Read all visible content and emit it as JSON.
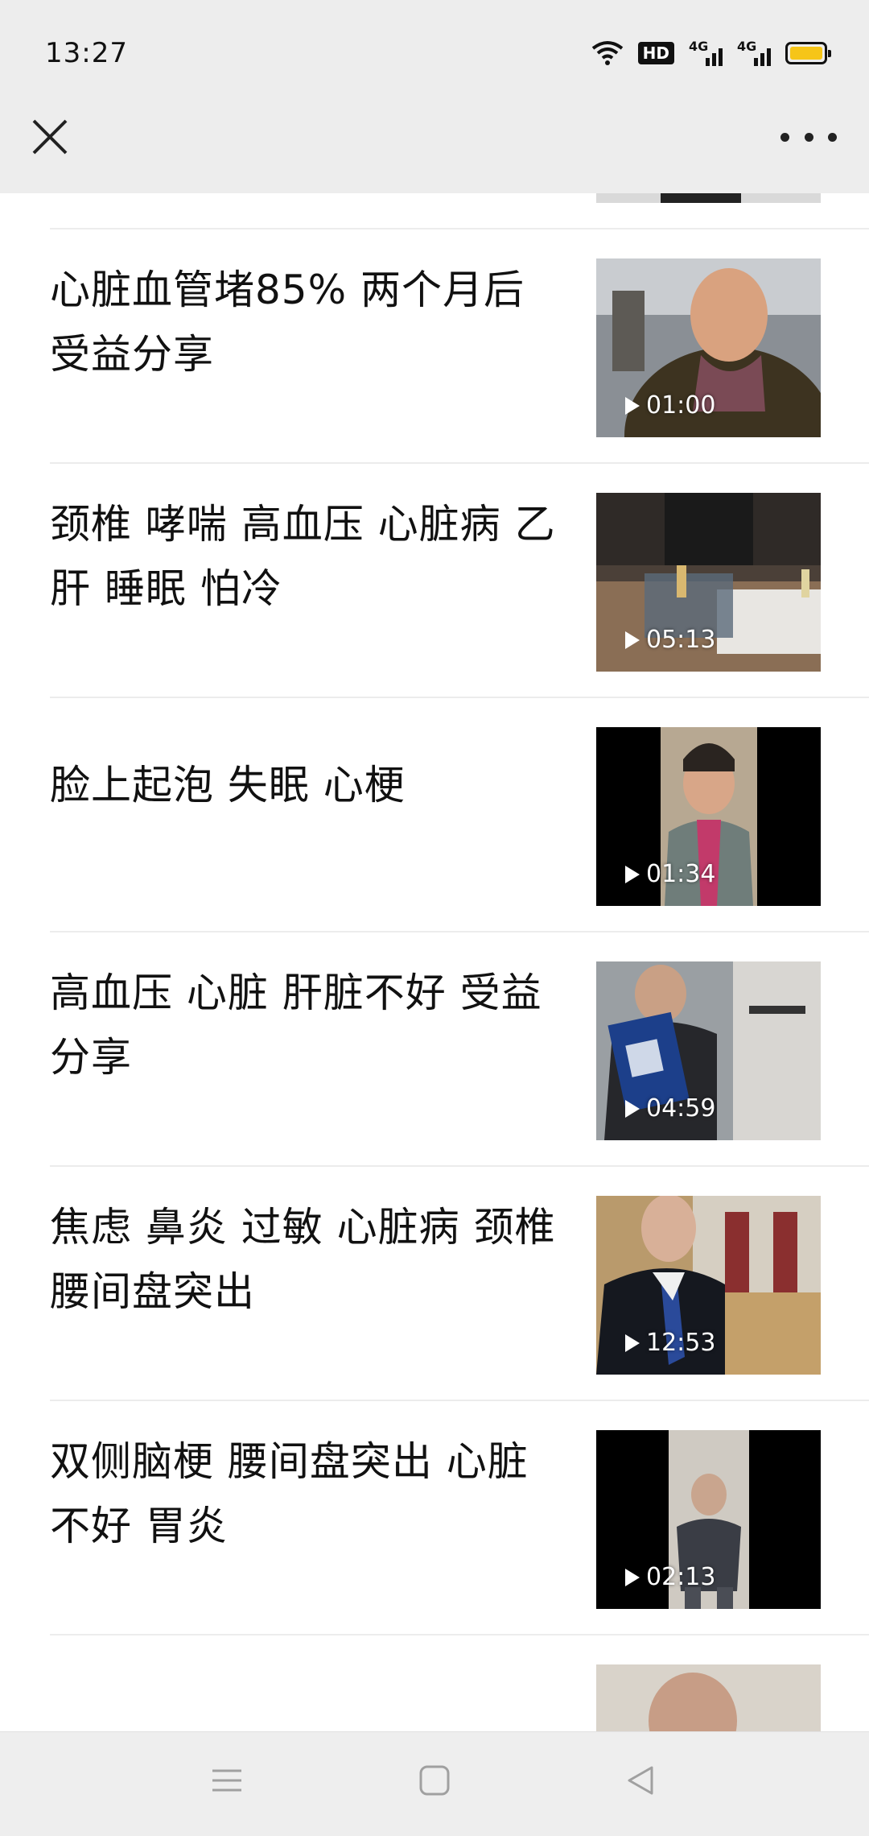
{
  "status_bar": {
    "time": "13:27",
    "wifi_icon": "wifi-icon",
    "hd_badge": "HD",
    "network_1": "4G",
    "network_2": "4G",
    "battery_color": "#f6c518"
  },
  "nav_bar": {
    "close_icon": "close-icon",
    "more_icon": "more-dots-icon"
  },
  "videos": [
    {
      "title": "心脏血管堵85% 两个月后受益分享",
      "duration": "01:00"
    },
    {
      "title": "颈椎 哮喘 高血压 心脏病 乙肝 睡眠 怕冷",
      "duration": "05:13"
    },
    {
      "title": "脸上起泡 失眠 心梗",
      "duration": "01:34"
    },
    {
      "title": "高血压 心脏 肝脏不好 受益分享",
      "duration": "04:59"
    },
    {
      "title": "焦虑 鼻炎 过敏 心脏病 颈椎 腰间盘突出",
      "duration": "12:53"
    },
    {
      "title": "双侧脑梗 腰间盘突出 心脏不好 胃炎",
      "duration": "02:13"
    }
  ],
  "bottom_nav": {
    "menu_icon": "menu-icon",
    "home_icon": "home-square-icon",
    "back_icon": "back-triangle-icon"
  }
}
